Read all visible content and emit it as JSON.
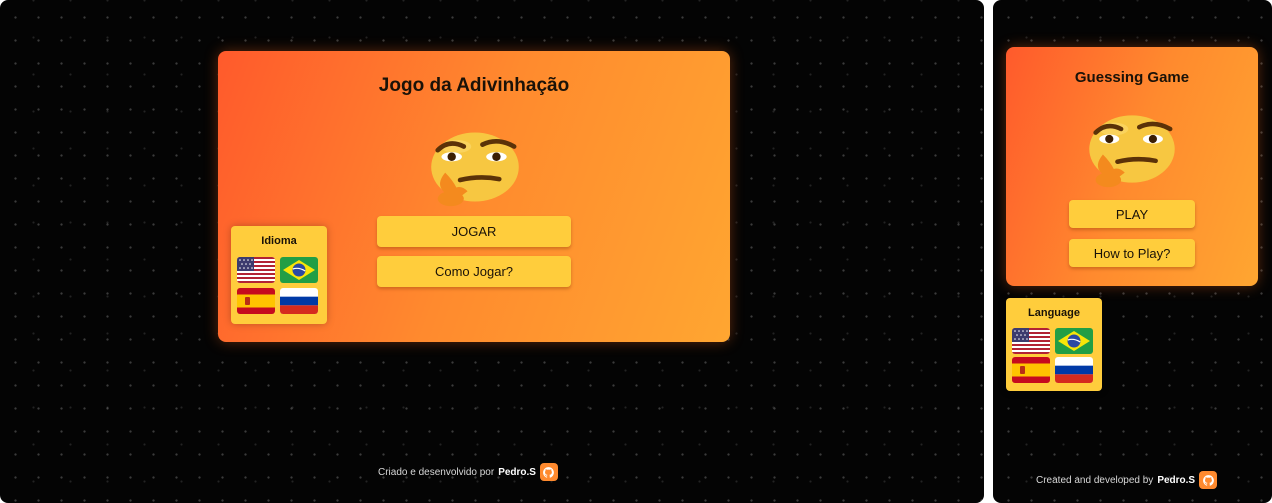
{
  "desktop": {
    "title": "Jogo da Adivinhação",
    "buttons": {
      "play": "JOGAR",
      "how_to": "Como Jogar?"
    },
    "language": {
      "title": "Idioma"
    },
    "footer": {
      "text": "Criado e desenvolvido por",
      "author": "Pedro.S"
    }
  },
  "mobile": {
    "title": "Guessing Game",
    "buttons": {
      "play": "PLAY",
      "how_to": "How to Play?"
    },
    "language": {
      "title": "Language"
    },
    "footer": {
      "text": "Created and developed by",
      "author": "Pedro.S"
    }
  },
  "icons": {
    "emoji": "thinking-face-icon",
    "github": "github-icon",
    "flags": [
      "flag-usa-icon",
      "flag-brazil-icon",
      "flag-spain-icon",
      "flag-russia-icon"
    ]
  },
  "colors": {
    "background": "#040404",
    "card_gradient_start": "#ff5a2c",
    "card_gradient_end": "#ffa631",
    "button": "#ffcd3c",
    "text_dark": "#1a1208"
  }
}
